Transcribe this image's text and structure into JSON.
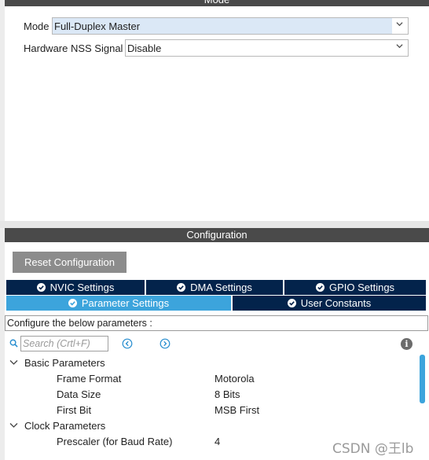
{
  "mode_panel": {
    "title": "Mode",
    "mode_label": "Mode",
    "mode_value": "Full-Duplex Master",
    "nss_label": "Hardware NSS Signal",
    "nss_value": "Disable"
  },
  "config_panel": {
    "title": "Configuration",
    "reset_button": "Reset Configuration",
    "tabs_row1": [
      {
        "label": "NVIC Settings"
      },
      {
        "label": "DMA Settings"
      },
      {
        "label": "GPIO Settings"
      }
    ],
    "tabs_row2": [
      {
        "label": "Parameter Settings",
        "active": true
      },
      {
        "label": "User Constants",
        "active": false
      }
    ],
    "info_text": "Configure the below parameters :",
    "search_placeholder": "Search (Crtl+F)",
    "groups": [
      {
        "name": "Basic Parameters",
        "params": [
          {
            "name": "Frame Format",
            "value": "Motorola"
          },
          {
            "name": "Data Size",
            "value": "8 Bits"
          },
          {
            "name": "First Bit",
            "value": "MSB First"
          }
        ]
      },
      {
        "name": "Clock Parameters",
        "params": [
          {
            "name": "Prescaler (for Baud Rate)",
            "value": "4"
          }
        ]
      }
    ]
  },
  "watermark": "CSDN @王lb",
  "colors": {
    "header_bar": "#4a4a4a",
    "tab_dark": "#03234b",
    "tab_active": "#3ca4dc",
    "button_gray": "#8c8c8c",
    "select_highlight": "#dbe8f6"
  }
}
